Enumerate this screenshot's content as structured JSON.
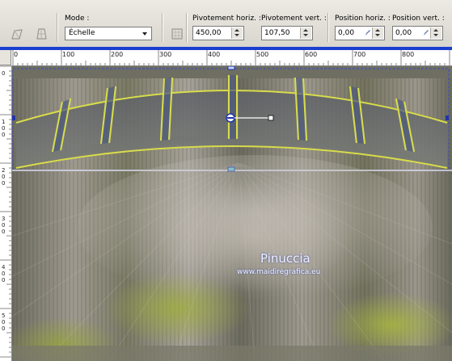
{
  "toolbar": {
    "mode_label": "Mode :",
    "mode_value": "Échelle",
    "pivot_h_label": "Pivotement horiz. :",
    "pivot_h_value": "450,00",
    "pivot_v_label": "Pivotement vert. :",
    "pivot_v_value": "107,50",
    "pos_h_label": "Position horiz. :",
    "pos_h_value": "0,00",
    "pos_v_label": "Position vert. :",
    "pos_v_value": "0,00",
    "icons": [
      "deform-tool-icon",
      "perspective-tool-icon",
      "grid-tool-icon"
    ]
  },
  "rulers": {
    "horizontal_labels": [
      "0",
      "100",
      "200",
      "300",
      "400",
      "500",
      "600",
      "700",
      "800"
    ],
    "vertical_labels": [
      "0",
      "100",
      "200",
      "300",
      "400",
      "500"
    ]
  },
  "canvas": {
    "watermark_name": "Pinuccia",
    "watermark_url": "www.maidiregrafica.eu"
  },
  "colors": {
    "accent_blue": "#1a3fd0",
    "frame_yellow": "#d8dc4a"
  }
}
